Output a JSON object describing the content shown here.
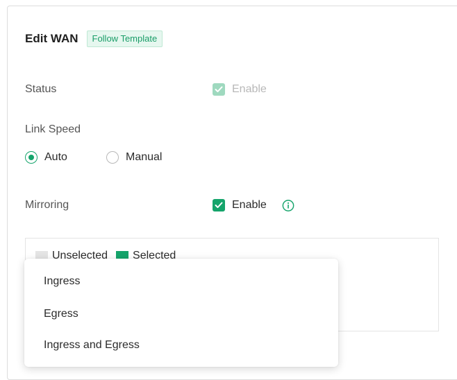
{
  "header": {
    "title": "Edit WAN",
    "badge": "Follow Template"
  },
  "status": {
    "label": "Status",
    "checkbox_label": "Enable",
    "checked": true,
    "disabled": true
  },
  "link_speed": {
    "label": "Link Speed",
    "options": [
      {
        "label": "Auto",
        "selected": true
      },
      {
        "label": "Manual",
        "selected": false
      }
    ]
  },
  "mirroring": {
    "label": "Mirroring",
    "checkbox_label": "Enable",
    "checked": true,
    "info_icon": "info-icon"
  },
  "legend": {
    "unselected": "Unselected",
    "selected": "Selected"
  },
  "dropdown": {
    "options": [
      "Ingress",
      "Egress",
      "Ingress and Egress"
    ]
  },
  "colors": {
    "accent": "#15a46b",
    "accent_disabled": "#9fd9bf",
    "badge_bg": "#e6f7ef"
  }
}
